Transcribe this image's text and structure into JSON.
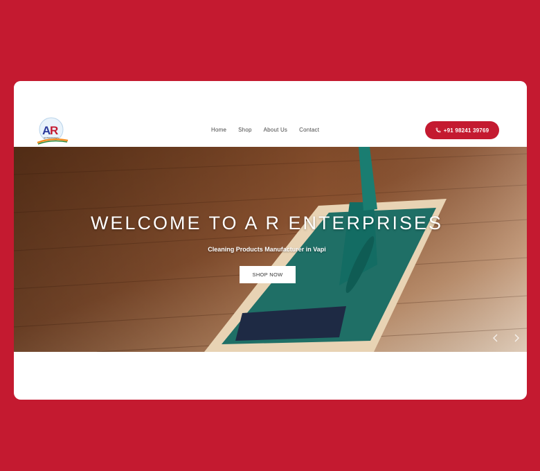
{
  "brand": {
    "logo_text": "R",
    "logo_sub": "ENTERPRISES",
    "logo_letter_a": "A"
  },
  "nav": {
    "items": [
      "Home",
      "Shop",
      "About Us",
      "Contact"
    ]
  },
  "header": {
    "phone": "+91 98241 39769"
  },
  "hero": {
    "title": "WELCOME TO A R ENTERPRISES",
    "subtitle": "Cleaning Products Manufacturer in Vapi",
    "button": "SHOP NOW"
  },
  "colors": {
    "brand_red": "#c41a30",
    "white": "#ffffff"
  },
  "icons": {
    "phone": "phone-icon",
    "prev": "chevron-left-icon",
    "next": "chevron-right-icon"
  }
}
